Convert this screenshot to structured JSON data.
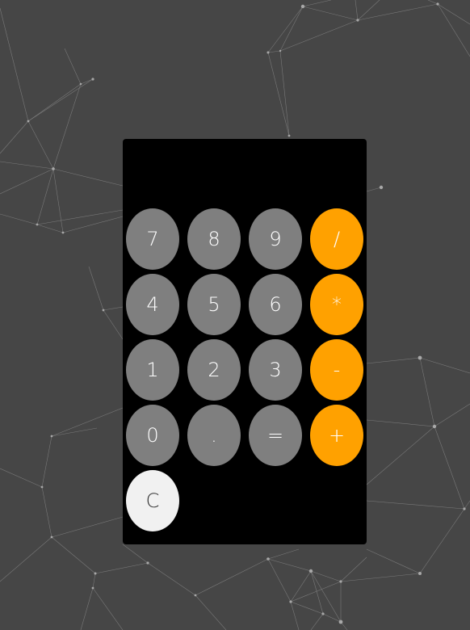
{
  "display": {
    "value": ""
  },
  "keys": {
    "seven": "7",
    "eight": "8",
    "nine": "9",
    "divide": "/",
    "four": "4",
    "five": "5",
    "six": "6",
    "multiply": "*",
    "one": "1",
    "two": "2",
    "three": "3",
    "subtract": "-",
    "zero": "0",
    "decimal": ".",
    "equals": "=",
    "add": "+",
    "clear": "C"
  },
  "colors": {
    "background": "#464646",
    "calculator_body": "#000000",
    "number_key": "#7f7f7f",
    "operator_key": "#ffa100",
    "clear_key": "#f1f1f1",
    "network_lines": "#8a8a8a"
  }
}
